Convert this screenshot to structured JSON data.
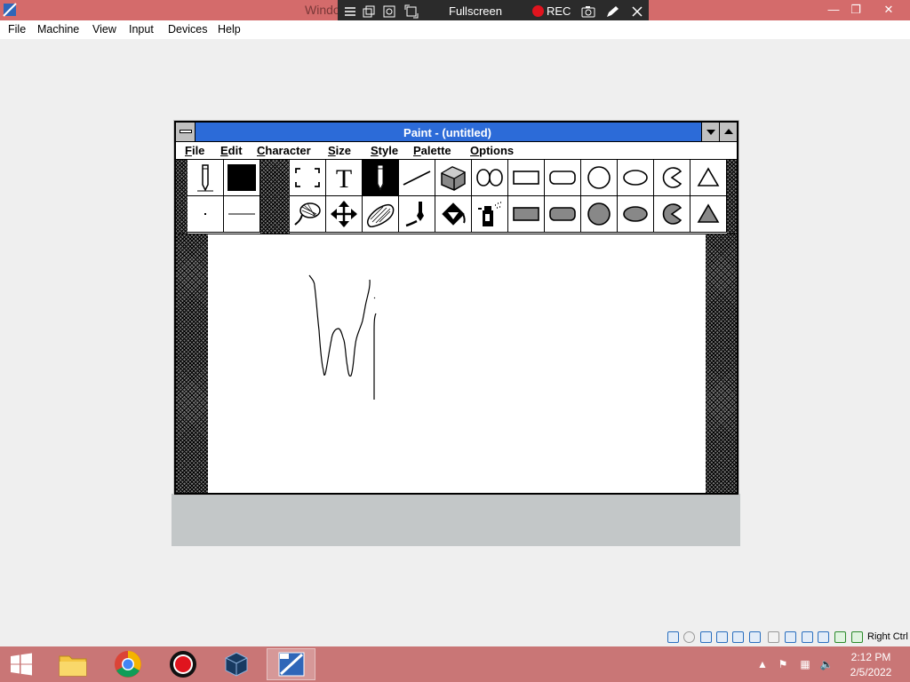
{
  "host": {
    "title": "Windo",
    "menu": [
      "File",
      "Machine",
      "View",
      "Input",
      "Devices",
      "Help"
    ],
    "fullscreen_bar": {
      "fullscreen_label": "Fullscreen",
      "rec_label": "REC"
    },
    "status_bar": {
      "host_key_label": "Right Ctrl"
    }
  },
  "paint": {
    "title": "Paint - (untitled)",
    "menu": [
      {
        "first": "F",
        "rest": "ile"
      },
      {
        "first": "E",
        "rest": "dit"
      },
      {
        "first": "C",
        "rest": "haracter"
      },
      {
        "first": "S",
        "rest": "ize"
      },
      {
        "first": "S",
        "rest": "tyle"
      },
      {
        "first": "P",
        "rest": "alette"
      },
      {
        "first": "O",
        "rest": "ptions"
      }
    ],
    "selected_tool": "pencil",
    "tools_row1": [
      "selection-box",
      "text",
      "pencil",
      "line",
      "3d-box",
      "curve",
      "rectangle",
      "rounded-rectangle",
      "circle",
      "ellipse",
      "pie",
      "polygon"
    ],
    "tools_row2": [
      "lasso",
      "move",
      "eraser",
      "brush",
      "paint-roller",
      "spray-can",
      "filled-rectangle",
      "filled-rounded-rectangle",
      "filled-circle",
      "filled-ellipse",
      "filled-pie",
      "filled-polygon"
    ]
  },
  "taskbar": {
    "clock_time": "2:12 PM",
    "clock_date": "2/5/2022",
    "apps": [
      "file-explorer",
      "chrome",
      "recorder",
      "virtualbox",
      "windows-3-vm"
    ]
  },
  "colors": {
    "host_titlebar": "#d46b6b",
    "taskbar": "#c97676",
    "paint_titlebar": "#2c6bd8",
    "rec": "#e0141e"
  }
}
